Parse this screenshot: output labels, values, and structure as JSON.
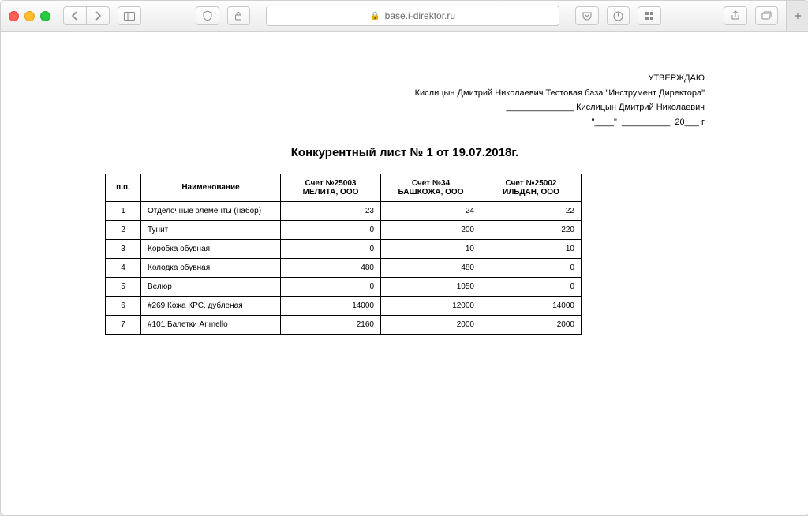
{
  "browser": {
    "url_host": "base.i-direktor.ru"
  },
  "approve": {
    "title": "УТВЕРЖДАЮ",
    "line2": "Кислицын Дмитрий Николаевич  Тестовая база \"Инструмент Директора\"",
    "signer": "Кислицын Дмитрий Николаевич",
    "date_template": "\"____\"  __________  20___ г"
  },
  "doc": {
    "title": "Конкурентный лист № 1 от 19.07.2018г."
  },
  "table": {
    "headers": {
      "n": "п.п.",
      "name": "Наименование",
      "c1a": "Счет №25003",
      "c1b": "МЕЛИТА, ООО",
      "c2a": "Счет №34",
      "c2b": "БАШКОЖА, ООО",
      "c3a": "Счет №25002",
      "c3b": "ИЛЬДАН, ООО"
    },
    "rows": [
      {
        "n": "1",
        "name": "Отделочные элементы (набор)",
        "c1": "23",
        "c2": "24",
        "c3": "22"
      },
      {
        "n": "2",
        "name": "Тунит",
        "c1": "0",
        "c2": "200",
        "c3": "220"
      },
      {
        "n": "3",
        "name": "Коробка обувная",
        "c1": "0",
        "c2": "10",
        "c3": "10"
      },
      {
        "n": "4",
        "name": "Колодка обувная",
        "c1": "480",
        "c2": "480",
        "c3": "0"
      },
      {
        "n": "5",
        "name": "Велюр",
        "c1": "0",
        "c2": "1050",
        "c3": "0"
      },
      {
        "n": "6",
        "name": "#269 Кожа КРС, дубленая",
        "c1": "14000",
        "c2": "12000",
        "c3": "14000"
      },
      {
        "n": "7",
        "name": "#101 Балетки Arimello",
        "c1": "2160",
        "c2": "2000",
        "c3": "2000"
      }
    ]
  }
}
